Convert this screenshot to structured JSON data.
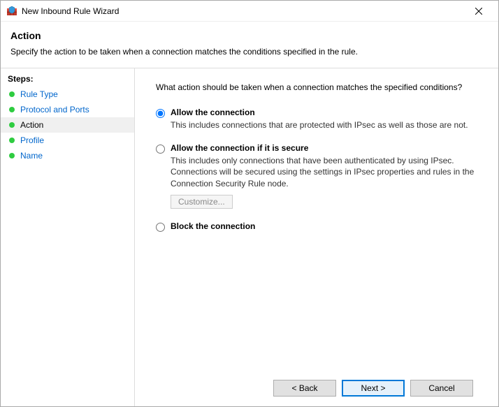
{
  "window": {
    "title": "New Inbound Rule Wizard"
  },
  "header": {
    "heading": "Action",
    "description": "Specify the action to be taken when a connection matches the conditions specified in the rule."
  },
  "sidebar": {
    "heading": "Steps:",
    "items": [
      {
        "label": "Rule Type",
        "active": false
      },
      {
        "label": "Protocol and Ports",
        "active": false
      },
      {
        "label": "Action",
        "active": true
      },
      {
        "label": "Profile",
        "active": false
      },
      {
        "label": "Name",
        "active": false
      }
    ]
  },
  "content": {
    "prompt": "What action should be taken when a connection matches the specified conditions?",
    "options": {
      "allow": {
        "title": "Allow the connection",
        "desc": "This includes connections that are protected with IPsec as well as those are not."
      },
      "allow_secure": {
        "title": "Allow the connection if it is secure",
        "desc": "This includes only connections that have been authenticated by using IPsec.  Connections will be secured using the settings in IPsec properties and rules in the Connection Security Rule node.",
        "customize_label": "Customize..."
      },
      "block": {
        "title": "Block the connection"
      }
    }
  },
  "footer": {
    "back": "< Back",
    "next": "Next >",
    "cancel": "Cancel"
  }
}
